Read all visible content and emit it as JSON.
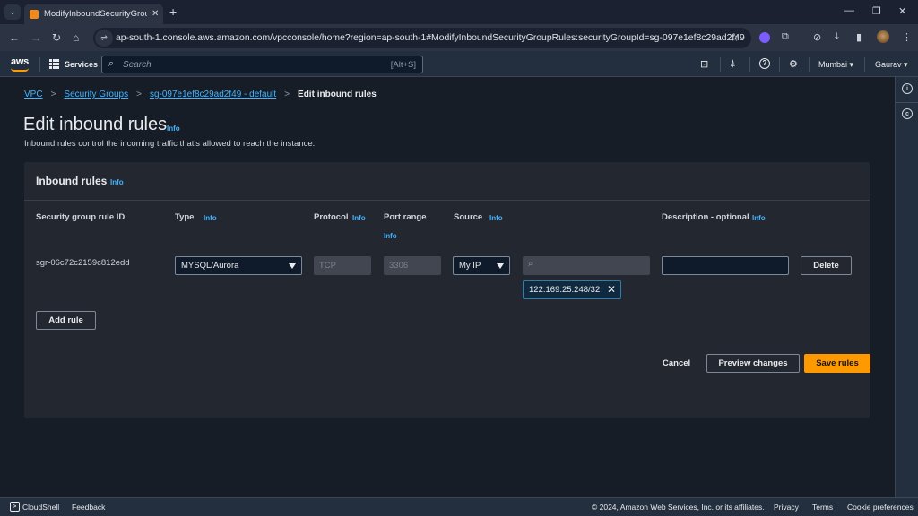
{
  "browser": {
    "tab_title": "ModifyInboundSecurityGroupRules",
    "url": "ap-south-1.console.aws.amazon.com/vpcconsole/home?region=ap-south-1#ModifyInboundSecurityGroupRules:securityGroupId=sg-097e1ef8c29ad2f49",
    "icons": {
      "tab_list": "chevron-down-icon",
      "new_tab": "plus-icon",
      "back": "arrow-left-icon",
      "forward": "arrow-right-icon",
      "reload": "reload-icon",
      "home": "home-icon",
      "bookmark": "star-icon",
      "minimize": "minimize-icon",
      "maximize": "restore-icon",
      "close": "close-icon"
    },
    "glyphs": {
      "tab_list": "⌄",
      "tab_close": "✕",
      "new_tab": "+",
      "minimize": "—",
      "maximize": "❐",
      "close": "✕",
      "back": "←",
      "forward": "→",
      "reload": "↻",
      "home": "⌂",
      "site_info": "⇌",
      "star": "☆",
      "extensions": "⧉",
      "ext2": "⊘",
      "download": "⤓",
      "sidebar": "▮",
      "menu": "⋮"
    }
  },
  "aws_header": {
    "logo": "aws",
    "services_label": "Services",
    "search_placeholder": "Search",
    "search_shortcut": "[Alt+S]",
    "search_glyph": "⌕",
    "icons": {
      "cloudshell": "⊡",
      "notifications": "⍋",
      "help": "?",
      "settings": "⚙"
    },
    "region": "Mumbai ▾",
    "user": "Gaurav ▾"
  },
  "side_rail": {
    "info_glyph": "i",
    "feedback_glyph": "c"
  },
  "breadcrumb": {
    "items": [
      "VPC",
      "Security Groups",
      "sg-097e1ef8c29ad2f49 - default"
    ],
    "current": "Edit inbound rules",
    "separator": ">"
  },
  "page": {
    "title": "Edit inbound rules",
    "title_info": "Info",
    "description": "Inbound rules control the incoming traffic that's allowed to reach the instance."
  },
  "panel": {
    "title": "Inbound rules",
    "title_info": "Info",
    "columns": [
      {
        "label": "Security group rule ID",
        "info": ""
      },
      {
        "label": "Type",
        "info": "Info"
      },
      {
        "label": "Protocol",
        "info": "Info"
      },
      {
        "label": "Port range",
        "info": "Info"
      },
      {
        "label": "Source",
        "info": "Info"
      },
      {
        "label": "Description - optional",
        "info": "Info"
      }
    ],
    "rules": [
      {
        "rule_id": "sgr-06c72c2159c812edd",
        "type": "MYSQL/Aurora",
        "protocol": "TCP",
        "port_range": "3306",
        "source_type": "My IP",
        "cidr_search_value": "",
        "cidr_tokens": [
          "122.169.25.248/32"
        ],
        "description": "",
        "delete_label": "Delete"
      }
    ],
    "add_rule_label": "Add rule"
  },
  "actions": {
    "cancel": "Cancel",
    "preview": "Preview changes",
    "save": "Save rules"
  },
  "footer": {
    "cloudshell": "CloudShell",
    "feedback": "Feedback",
    "copyright": "© 2024, Amazon Web Services, Inc. or its affiliates.",
    "privacy": "Privacy",
    "terms": "Terms",
    "cookies": "Cookie preferences"
  },
  "colors": {
    "accent_link": "#42b4ff",
    "primary_button": "#ff9900",
    "token_border": "#2d7fae"
  }
}
